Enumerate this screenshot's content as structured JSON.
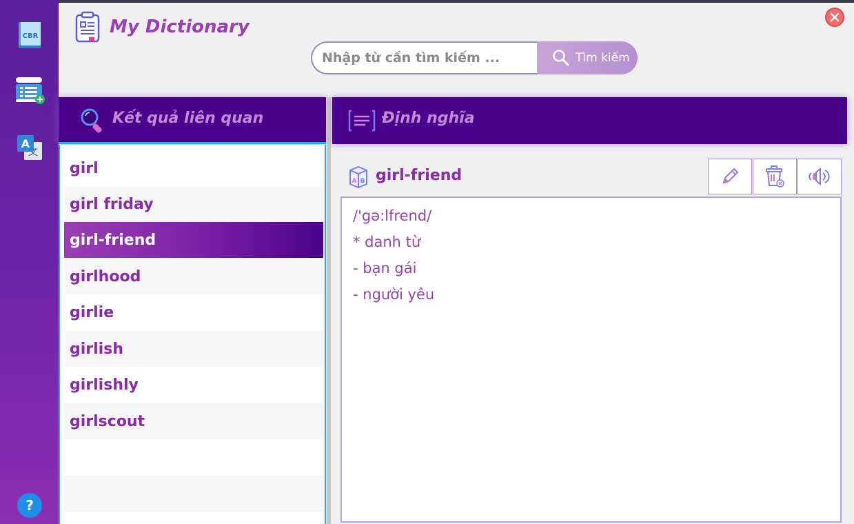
{
  "app": {
    "title": "My Dictionary",
    "accent": "#4a028c",
    "text_color": "#8a2aa8"
  },
  "sidebar": {
    "items": [
      {
        "icon": "cbr-book-icon",
        "label": "CBR"
      },
      {
        "icon": "add-list-icon"
      },
      {
        "icon": "translate-icon",
        "label": "A"
      },
      {
        "icon": "help-icon",
        "label": "?"
      }
    ]
  },
  "search": {
    "placeholder": "Nhập từ cần tìm kiếm ...",
    "button_label": "Tìm kiếm"
  },
  "results": {
    "header": "Kết quả liên quan",
    "items": [
      "girl",
      "girl friday",
      "girl-friend",
      "girlhood",
      "girlie",
      "girlish",
      "girlishly",
      "girlscout"
    ],
    "selected_index": 2
  },
  "definition": {
    "header": "Định nghĩa",
    "word": "girl-friend",
    "lines": [
      "/'gə:lfrend/",
      "* danh từ",
      "- bạn gái",
      "- người yêu"
    ],
    "actions": [
      "edit-icon",
      "delete-icon",
      "speaker-icon"
    ]
  }
}
